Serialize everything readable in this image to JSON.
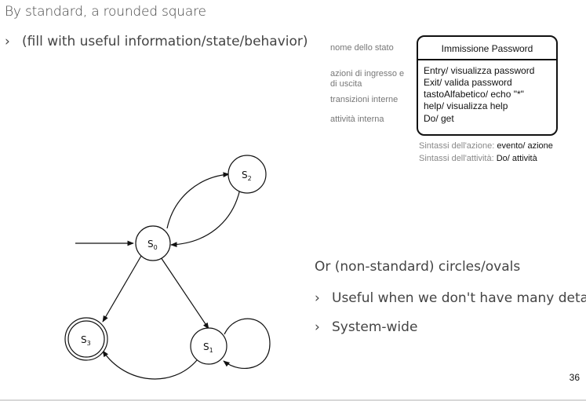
{
  "heading": "By standard, a rounded square",
  "bullet1": "(fill with useful information/state/behavior)",
  "chevron": "›",
  "labels": {
    "state_name": "nome dello stato",
    "entry_exit_1": "azioni di ingresso e",
    "entry_exit_2": "di uscita",
    "internal_transitions": "transizioni interne",
    "internal_activity": "attività interna"
  },
  "state_box": {
    "name": "Immissione Password",
    "lines": [
      "Entry/ visualizza password",
      "Exit/ valida password",
      "tastoAlfabetico/ echo \"*\"",
      "help/ visualizza help",
      "Do/ get"
    ]
  },
  "syntax": {
    "action_label": "Sintassi dell'azione:",
    "action_value": "evento/ azione",
    "activity_label": "Sintassi dell'attività:",
    "activity_value": "Do/ attività"
  },
  "alt_heading": "Or (non-standard) circles/ovals",
  "alt_bullets": [
    "Useful when we don't have many details",
    "System-wide"
  ],
  "states": {
    "s0": {
      "base": "S",
      "sub": "0"
    },
    "s1": {
      "base": "S",
      "sub": "1"
    },
    "s2": {
      "base": "S",
      "sub": "2"
    },
    "s3": {
      "base": "S",
      "sub": "3"
    }
  },
  "page_number": "36"
}
